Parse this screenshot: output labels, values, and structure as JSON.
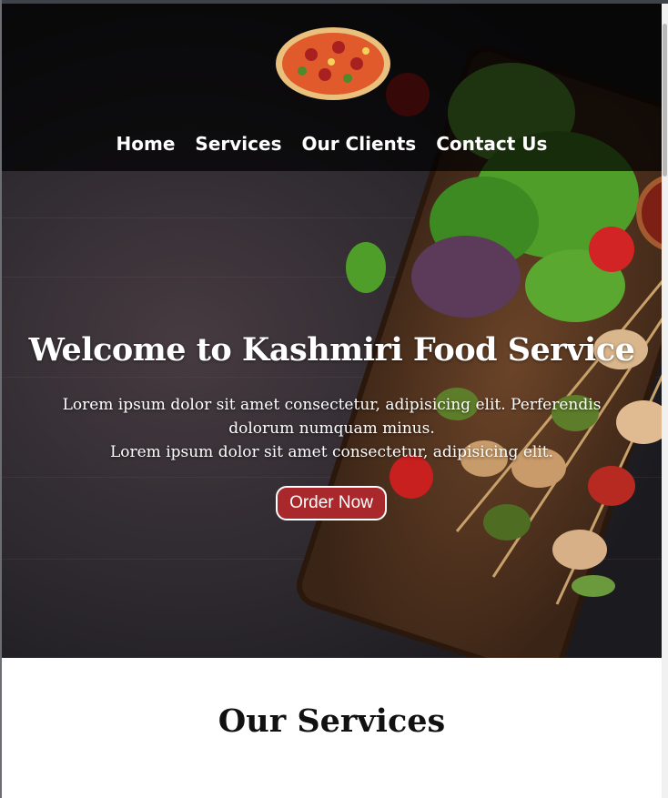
{
  "nav": {
    "items": [
      {
        "label": "Home"
      },
      {
        "label": "Services"
      },
      {
        "label": "Our Clients"
      },
      {
        "label": "Contact Us"
      }
    ]
  },
  "hero": {
    "title": "Welcome to Kashmiri Food Service",
    "line1": "Lorem ipsum dolor sit amet consectetur, adipisicing elit. Perferendis dolorum numquam minus.",
    "line2": "Lorem ipsum dolor sit amet consectetur, adipisicing elit.",
    "button_label": "Order Now"
  },
  "services": {
    "title": "Our Services"
  },
  "colors": {
    "button": "#a8282b",
    "navbar_overlay": "rgba(0,0,0,0.72)",
    "text": "#ffffff"
  },
  "icons": [
    "pizza-logo-icon",
    "tomato-icon",
    "kebab-board-icon",
    "parsley-icon"
  ]
}
